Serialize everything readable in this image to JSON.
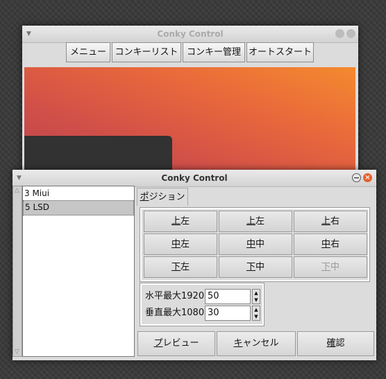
{
  "back_window": {
    "title": "Conky Control",
    "menu": [
      "メニュー",
      "コンキーリスト",
      "コンキー管理",
      "オートスタート"
    ]
  },
  "front_window": {
    "title": "Conky Control",
    "list_items": [
      "3 Miui",
      "5 LSD"
    ],
    "selected_item": "5 LSD",
    "tab": "ポジション",
    "tab_mnemonic": "ポ",
    "tab_rest": "ジション",
    "positions": [
      [
        {
          "mn": "上",
          "rest": "左"
        },
        {
          "mn": "上",
          "rest": "左"
        },
        {
          "mn": "上",
          "rest": "右"
        }
      ],
      [
        {
          "mn": "中",
          "rest": "左"
        },
        {
          "mn": "中",
          "rest": "中"
        },
        {
          "mn": "中",
          "rest": "右"
        }
      ],
      [
        {
          "mn": "下",
          "rest": "左"
        },
        {
          "mn": "下",
          "rest": "中"
        },
        {
          "mn": "下",
          "rest": "中"
        }
      ]
    ],
    "horizontal_label": "水平最大1920",
    "horizontal_value": "50",
    "vertical_label": "垂直最大1080",
    "vertical_value": "30",
    "buttons": {
      "preview_mn": "プ",
      "preview_rest": "レビュー",
      "cancel_mn": "キ",
      "cancel_rest": "ャンセル",
      "ok_mn": "確",
      "ok_rest": "認"
    },
    "colors": {
      "close_button": "#e8612c",
      "wallpaper_top": "#f48a2e",
      "wallpaper_bottom": "#b9464d"
    }
  }
}
